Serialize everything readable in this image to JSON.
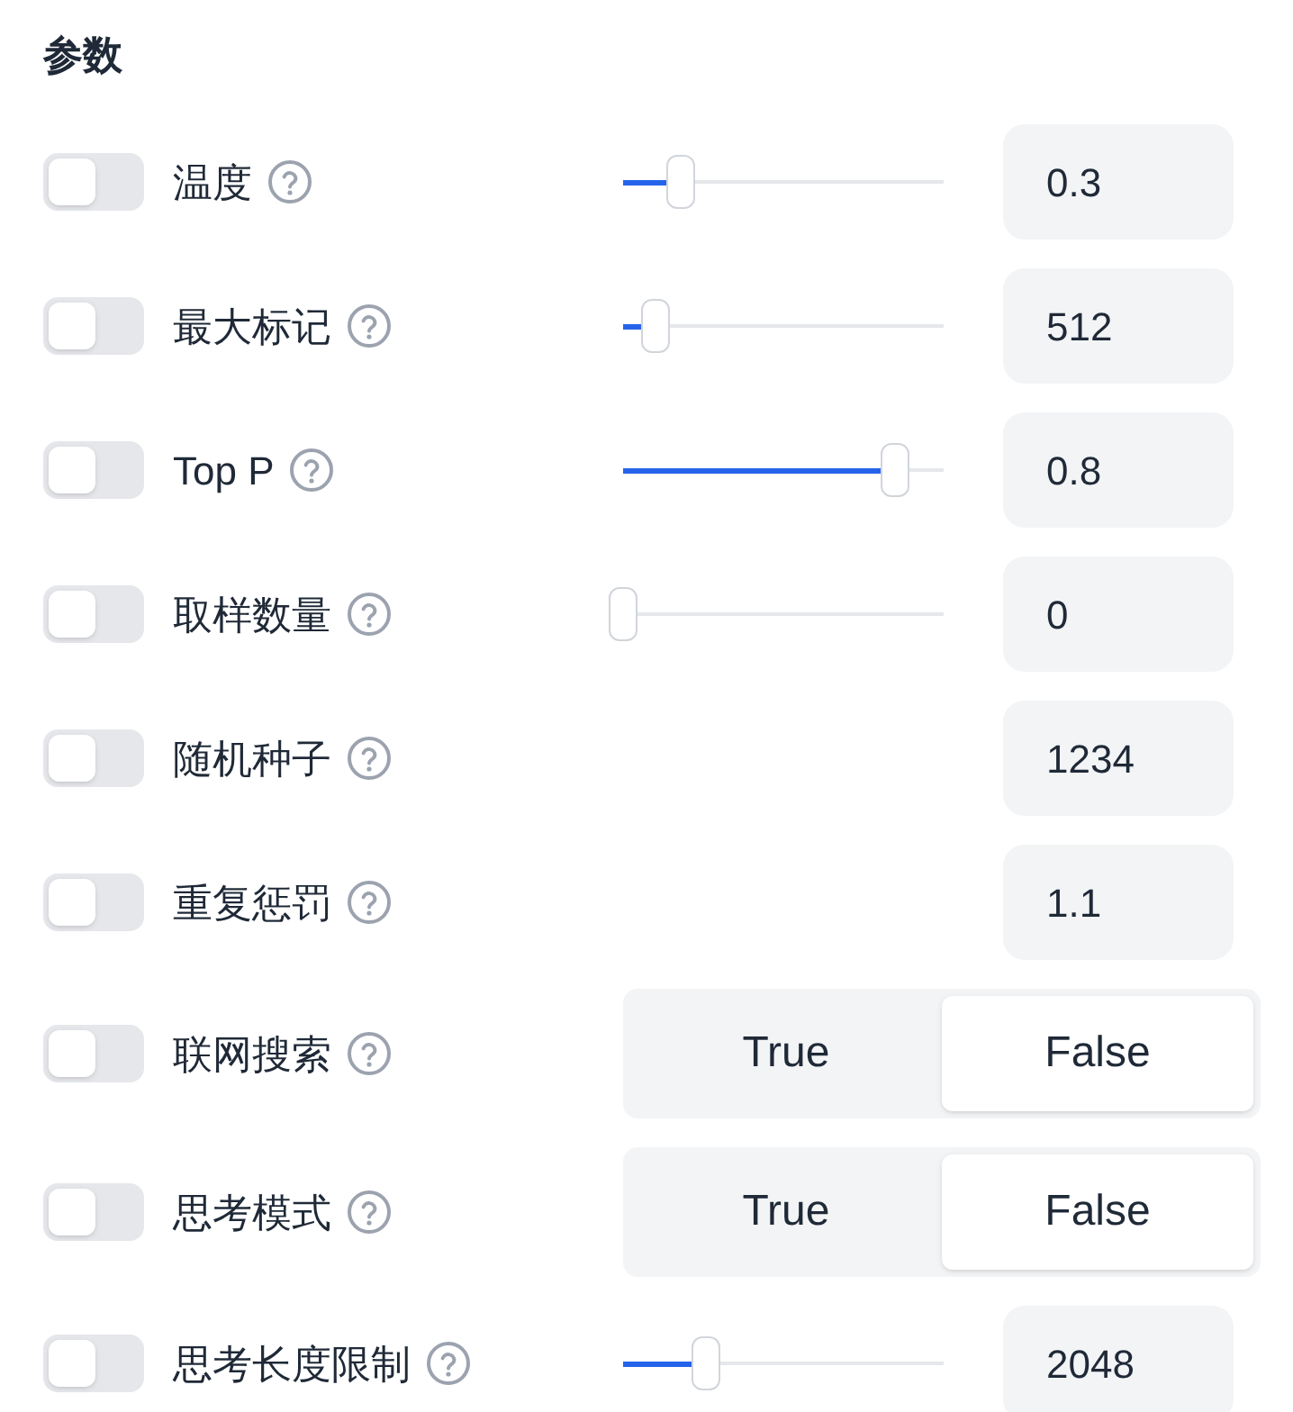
{
  "title": "参数",
  "params": [
    {
      "kind": "slider",
      "label": "温度",
      "on": false,
      "level": 0.18,
      "value": "0.3"
    },
    {
      "kind": "slider",
      "label": "最大标记",
      "on": false,
      "level": 0.1,
      "value": "512"
    },
    {
      "kind": "slider",
      "label": "Top P",
      "on": false,
      "level": 0.85,
      "value": "0.8"
    },
    {
      "kind": "slider",
      "label": "取样数量",
      "on": false,
      "level": 0.0,
      "value": "0"
    },
    {
      "kind": "number",
      "label": "随机种子",
      "on": false,
      "value": "1234"
    },
    {
      "kind": "number",
      "label": "重复惩罚",
      "on": false,
      "value": "1.1"
    },
    {
      "kind": "choice",
      "label": "联网搜索",
      "on": false,
      "options": [
        {
          "label": "True",
          "selected": false
        },
        {
          "label": "False",
          "selected": true
        }
      ]
    },
    {
      "kind": "choice",
      "label": "思考模式",
      "on": false,
      "options": [
        {
          "label": "True",
          "selected": false
        },
        {
          "label": "False",
          "selected": true
        }
      ]
    },
    {
      "kind": "slider",
      "label": "思考长度限制",
      "on": false,
      "level": 0.26,
      "value": "2048"
    }
  ]
}
